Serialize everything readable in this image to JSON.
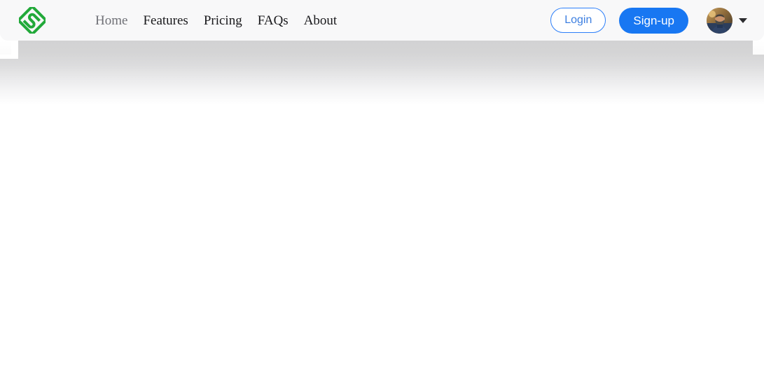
{
  "header": {
    "logo": {
      "icon": "diamond-s-logo-icon",
      "color": "#22a93a",
      "alt": "S"
    },
    "nav": [
      {
        "label": "Home",
        "name": "nav-link-home",
        "state": "muted"
      },
      {
        "label": "Features",
        "name": "nav-link-features",
        "state": "normal"
      },
      {
        "label": "Pricing",
        "name": "nav-link-pricing",
        "state": "normal"
      },
      {
        "label": "FAQs",
        "name": "nav-link-faqs",
        "state": "normal"
      },
      {
        "label": "About",
        "name": "nav-link-about",
        "state": "normal"
      }
    ],
    "actions": {
      "login_label": "Login",
      "login_border_color": "#2d7ff9",
      "login_text_color": "#3d7fe0",
      "signup_label": "Sign-up",
      "signup_background": "#1877f2",
      "signup_text_color": "#ffffff"
    },
    "user_menu": {
      "avatar_icon": "user-avatar-photo",
      "caret_icon": "chevron-down-icon"
    },
    "background": "#f8f8f9"
  },
  "body": {
    "background": "#ffffff",
    "content": ""
  }
}
